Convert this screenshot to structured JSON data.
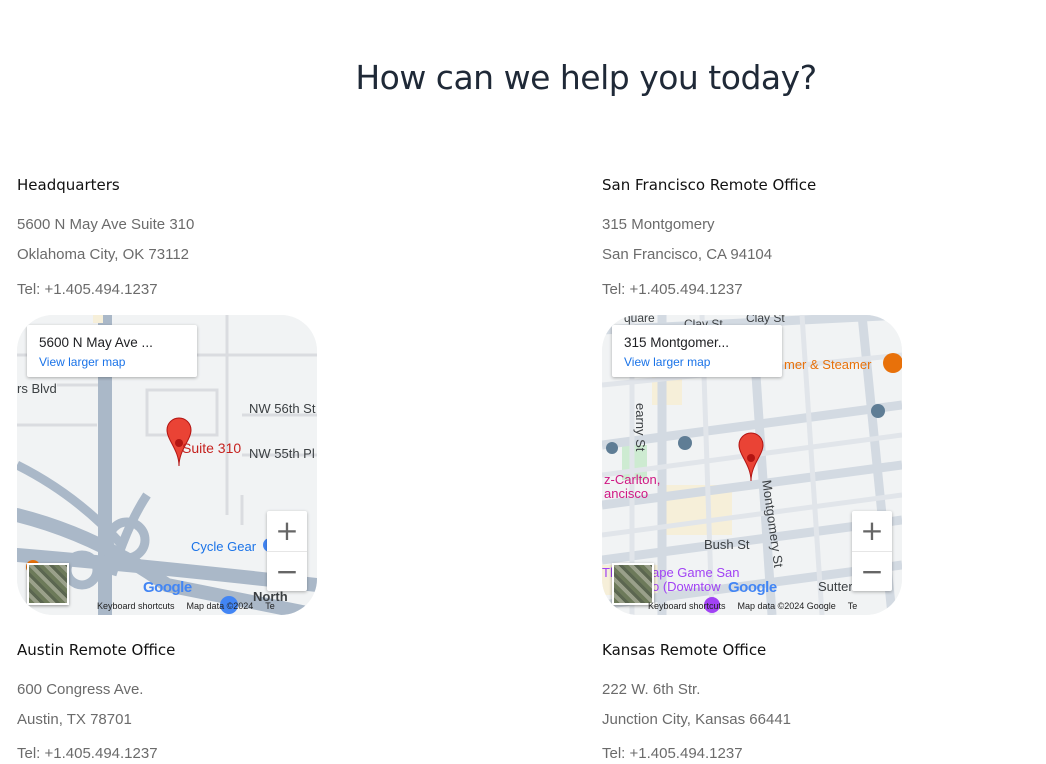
{
  "page": {
    "title": "How can we help you today?"
  },
  "offices": [
    {
      "name": "Headquarters",
      "address1": "5600 N May Ave Suite 310",
      "address2": "Oklahoma City, OK 73112",
      "tel": "Tel: +1.405.494.1237",
      "map": {
        "place": "5600 N May Ave ...",
        "view_larger": "View larger map",
        "pin_label": "Suite 310",
        "streets": [
          "rs Blvd",
          "NW 56th St",
          "NW 55th Pl",
          "North"
        ],
        "poi": "Cycle Gear",
        "footer": [
          "Keyboard shortcuts",
          "Map data ©2024",
          "Te"
        ]
      }
    },
    {
      "name": "San Francisco Remote Office",
      "address1": "315 Montgomery",
      "address2": "San Francisco, CA 94104",
      "tel": "Tel: +1.405.494.1237",
      "map": {
        "place": "315 Montgomer...",
        "view_larger": "View larger map",
        "streets": [
          "quare",
          "Clay St",
          "Clay St",
          "earny St",
          "Montgomery St",
          "Bush St",
          "Sutter St"
        ],
        "pois": [
          "mer & Steamer",
          "z-Carlton,",
          "ancisco",
          "Th",
          "ape Game San",
          "o (Downtow"
        ],
        "footer": [
          "Keyboard shortcuts",
          "Map data ©2024 Google",
          "Te"
        ]
      }
    },
    {
      "name": "Austin Remote Office",
      "address1": "600 Congress Ave.",
      "address2": "Austin, TX 78701",
      "tel": "Tel: +1.405.494.1237"
    },
    {
      "name": "Kansas Remote Office",
      "address1": "222 W. 6th Str.",
      "address2": "Junction City, Kansas 66441",
      "tel": "Tel: +1.405.494.1237"
    }
  ],
  "map_controls": {
    "zoom_in": "+",
    "zoom_out": "−",
    "logo": "Google"
  },
  "colors": {
    "pin": "#ea4335",
    "link": "#1a73e8",
    "road_major": "#aab8c8",
    "map_bg": "#f1f3f4"
  }
}
